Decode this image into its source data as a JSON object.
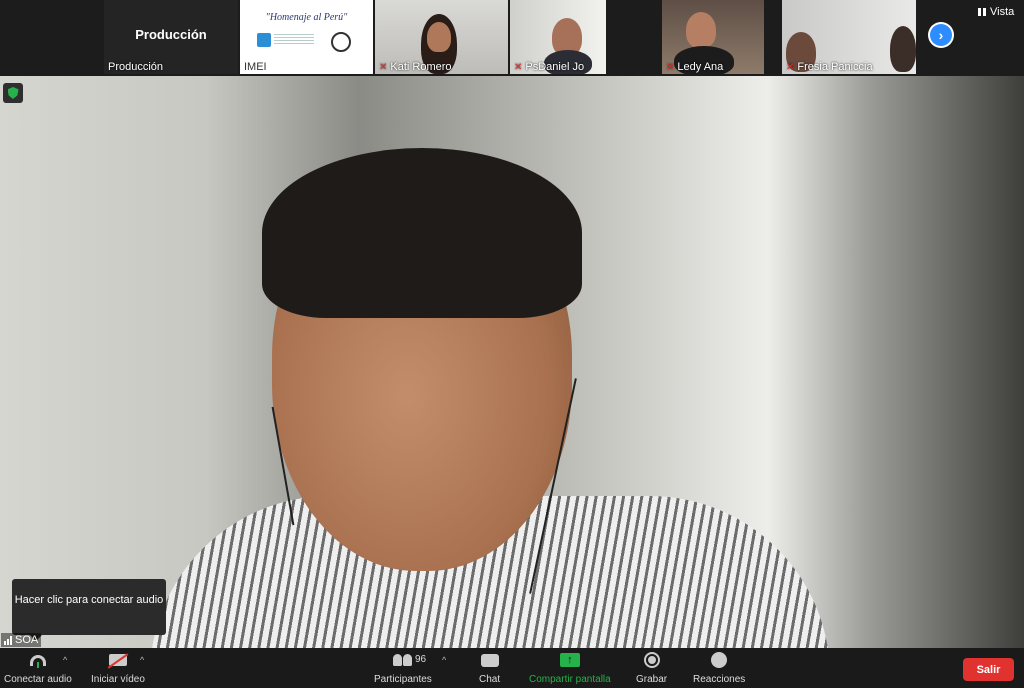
{
  "strip": {
    "prod_big": "Producción",
    "tiles": [
      {
        "name": "Producción"
      },
      {
        "name": "IMEI"
      },
      {
        "name": "Kati Romero"
      },
      {
        "name": "PsDaniel Jo"
      },
      {
        "name": "Ledy Ana"
      },
      {
        "name": "Fresia Paniccia"
      }
    ],
    "imei_banner": "\"Homenaje al Perú\"",
    "vista": "Vista"
  },
  "main": {
    "speaker_name": "SOA",
    "tooltip": "Hacer clic para conectar audio"
  },
  "toolbar": {
    "audio": "Conectar audio",
    "video": "Iniciar vídeo",
    "participants": "Participantes",
    "participants_count": "96",
    "chat": "Chat",
    "share": "Compartir pantalla",
    "record": "Grabar",
    "reactions": "Reacciones",
    "leave": "Salir"
  },
  "colors": {
    "share_green": "#25b24a",
    "leave_red": "#e0322f",
    "accent_blue": "#2d8cff"
  }
}
